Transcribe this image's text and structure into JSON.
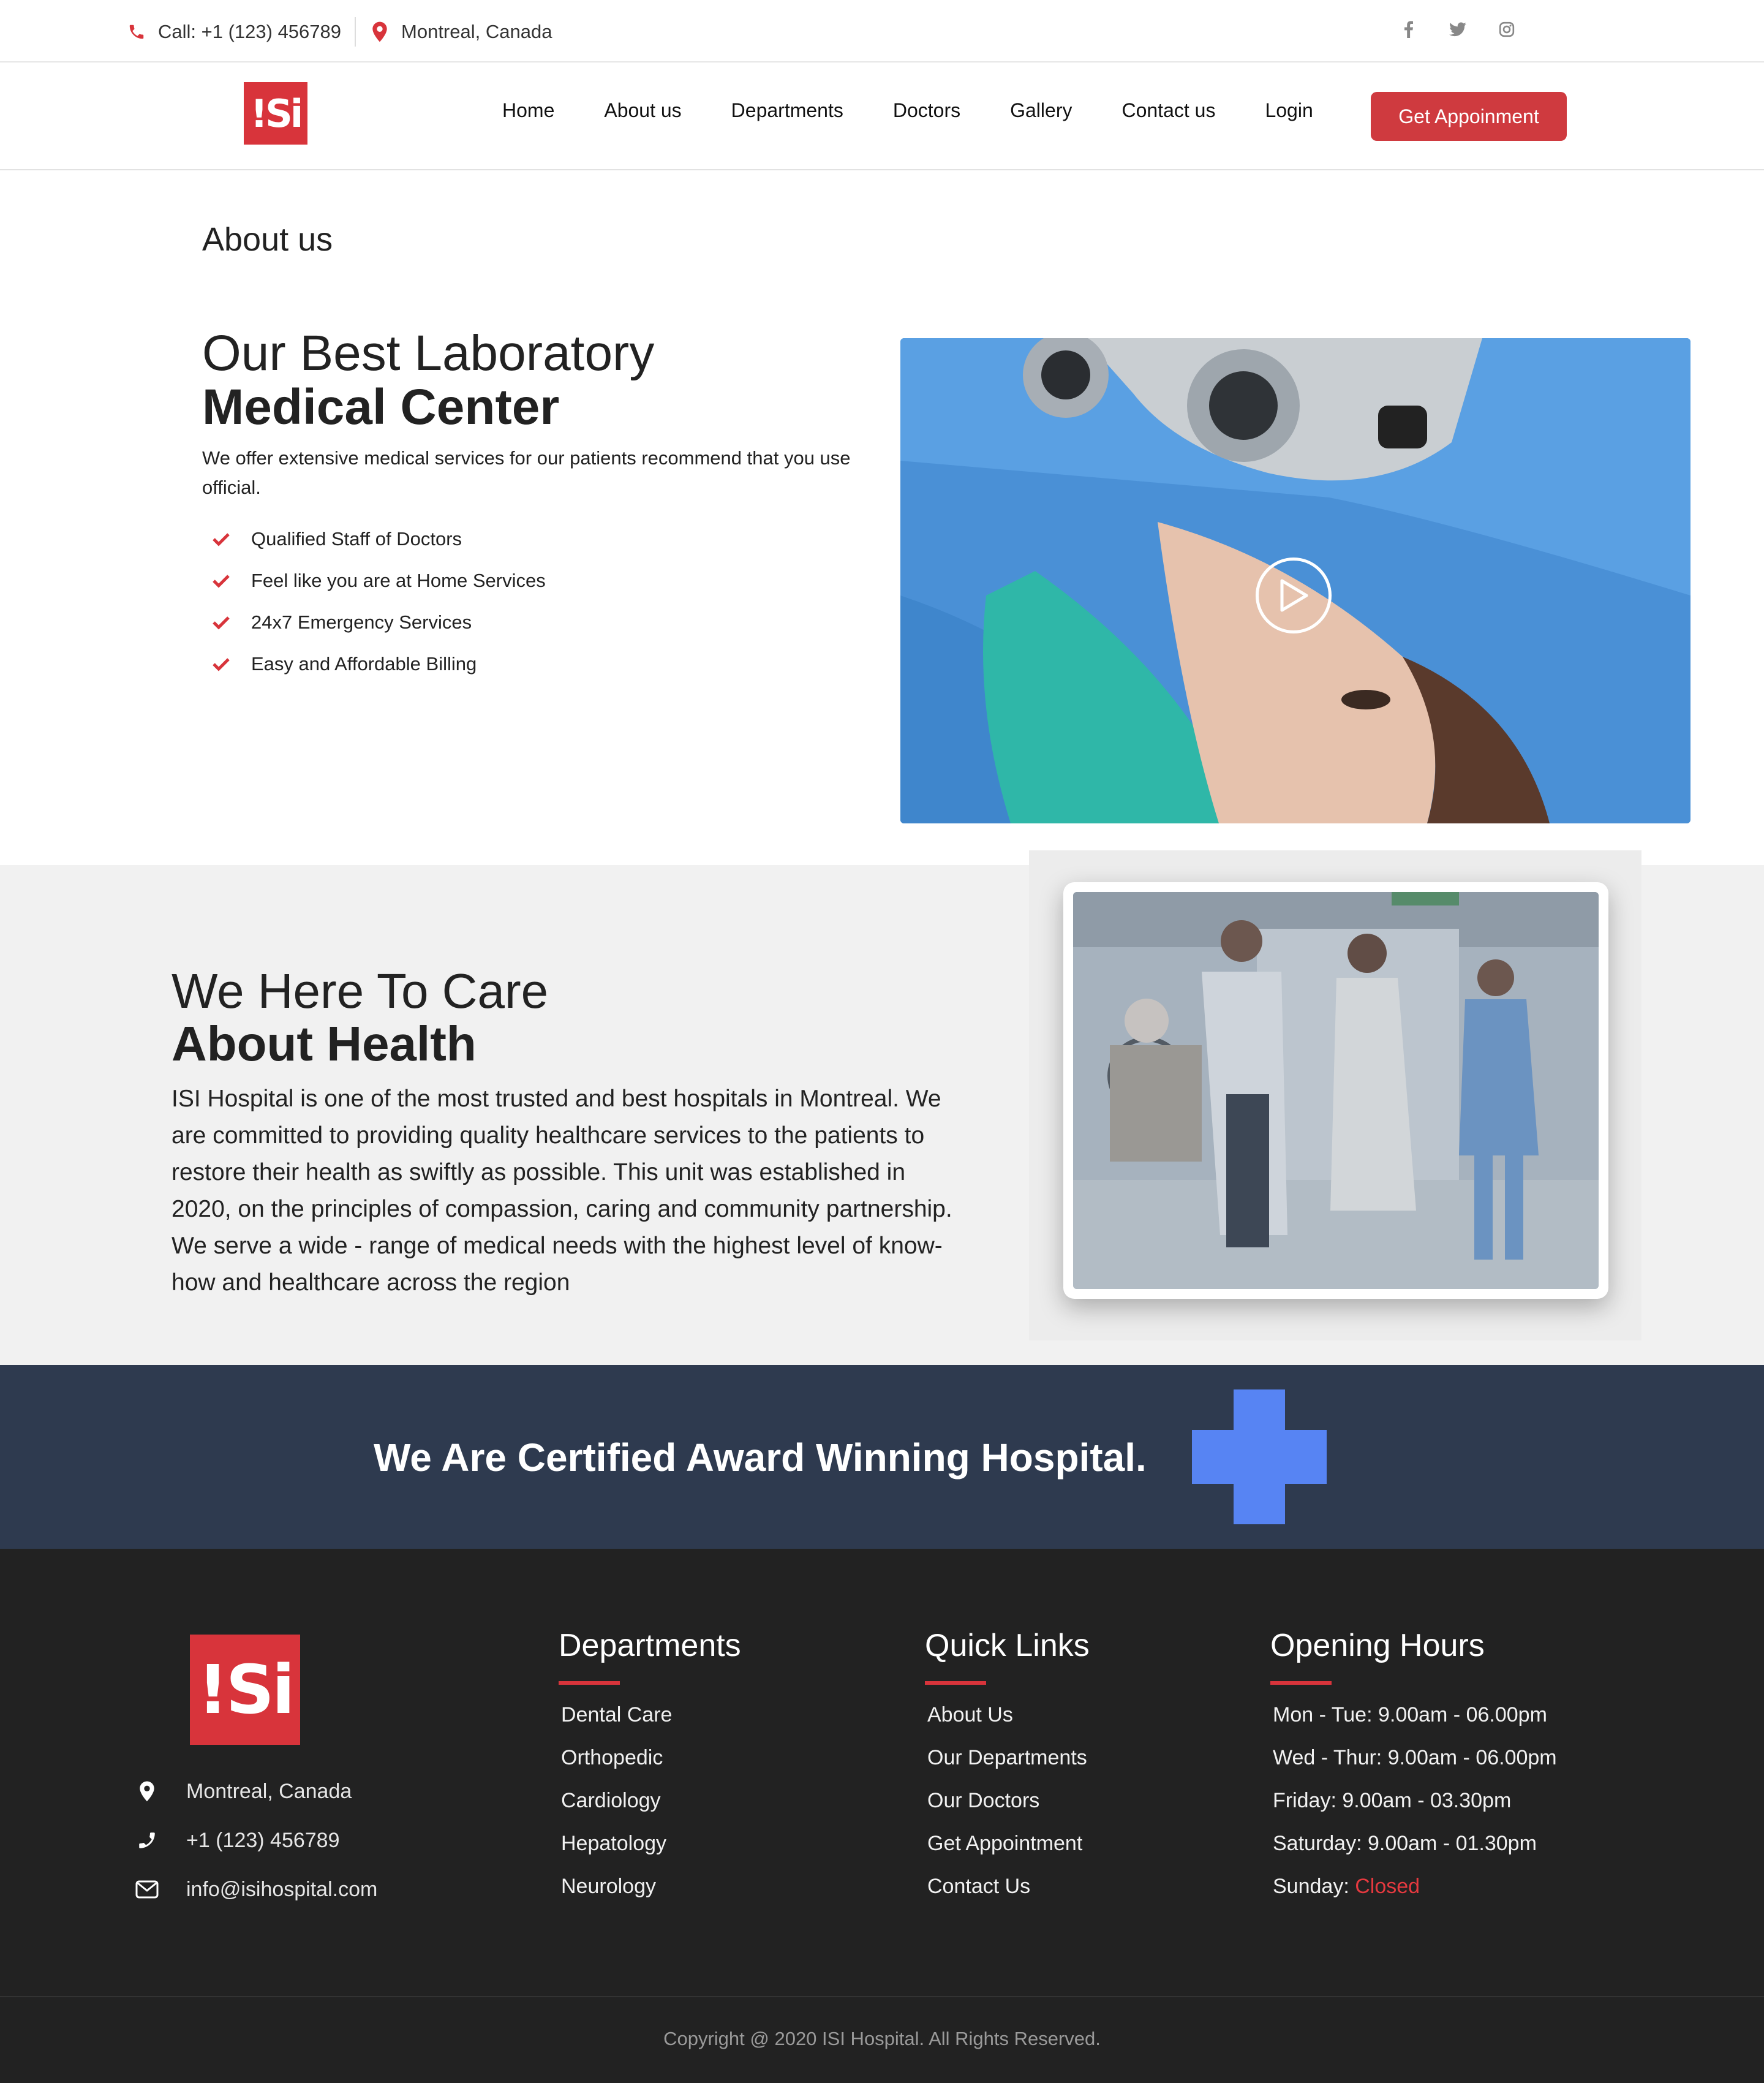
{
  "topbar": {
    "phone": "Call: +1 (123) 456789",
    "location": "Montreal, Canada",
    "social": [
      "facebook-icon",
      "twitter-icon",
      "instagram-icon"
    ]
  },
  "nav": {
    "logo": "!Si",
    "items": [
      "Home",
      "About us",
      "Departments",
      "Doctors",
      "Gallery",
      "Contact us",
      "Login"
    ],
    "cta": "Get Appoinment"
  },
  "about": {
    "page_title": "About us",
    "heading_light": "Our Best Laboratory",
    "heading_bold": "Medical Center",
    "description": "We offer extensive medical services for our patients recommend that you use official.",
    "features": [
      "Qualified Staff of Doctors",
      "Feel like you are at Home Services",
      "24x7 Emergency Services",
      "Easy and Affordable Billing"
    ]
  },
  "care": {
    "heading_light": "We Here To Care",
    "heading_bold": "About Health",
    "text": "ISI Hospital is one of the most trusted and best hospitals in Montreal. We are committed to providing quality healthcare services to the patients to restore their health as swiftly as possible. This unit was established in 2020, on the principles of compassion, caring and community partnership. We serve a wide - range of medical needs with the highest level of know-how and healthcare across the region"
  },
  "award": {
    "text": "We Are Certified Award Winning Hospital."
  },
  "footer": {
    "logo": "!Si",
    "contact": {
      "location": "Montreal, Canada",
      "phone": "+1 (123) 456789",
      "email": "info@isihospital.com"
    },
    "departments": {
      "title": "Departments",
      "items": [
        "Dental Care",
        "Orthopedic",
        "Cardiology",
        "Hepatology",
        "Neurology"
      ]
    },
    "quick_links": {
      "title": "Quick Links",
      "items": [
        "About Us",
        "Our Departments",
        "Our Doctors",
        "Get Appointment",
        "Contact Us"
      ]
    },
    "hours": {
      "title": "Opening Hours",
      "items": [
        "Mon - Tue: 9.00am - 06.00pm",
        "Wed - Thur: 9.00am - 06.00pm",
        "Friday: 9.00am - 03.30pm",
        "Saturday: 9.00am - 01.30pm"
      ],
      "sunday_label": "Sunday: ",
      "sunday_value": "Closed"
    },
    "copyright": "Copyright @ 2020 ISI Hospital. All Rights Reserved."
  },
  "colors": {
    "brand_red": "#d8343b",
    "navy": "#2e3a4f",
    "cross_blue": "#5784f3",
    "footer_bg": "#222222"
  }
}
